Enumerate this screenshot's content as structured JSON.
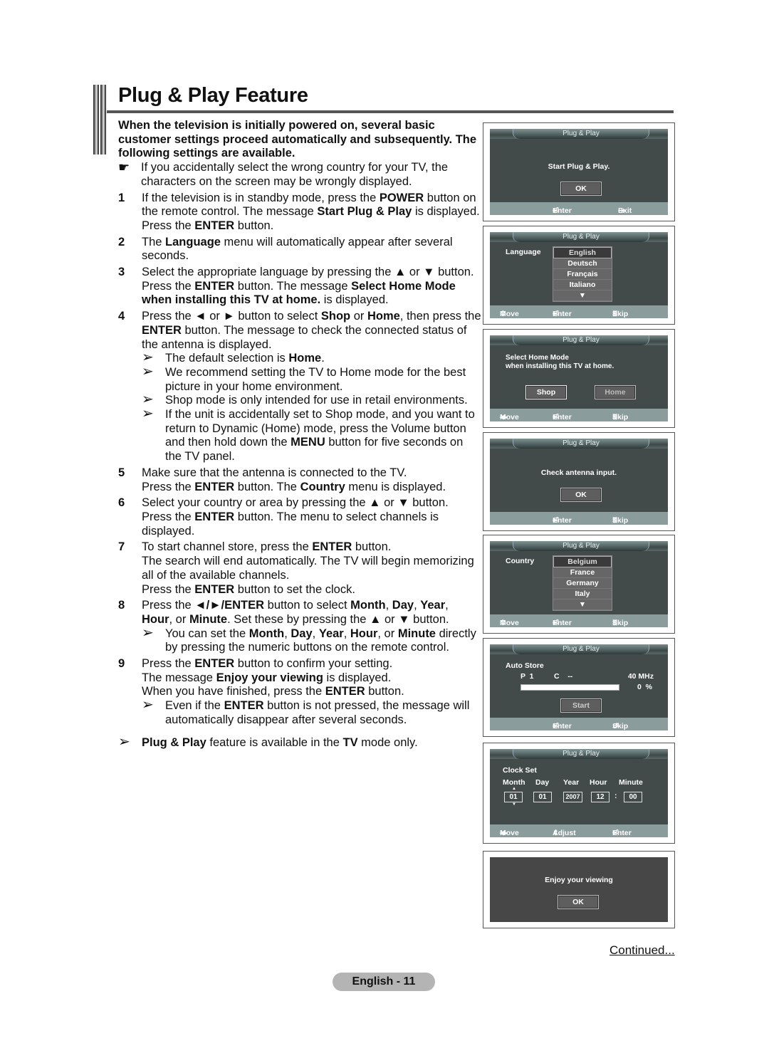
{
  "page": {
    "title": "Plug & Play Feature",
    "intro": "When the television is initially powered on, several basic customer settings proceed automatically and subsequently. The following settings are available.",
    "note": "If you accidentally select the wrong country for your TV, the characters on the screen may be wrongly displayed.",
    "continued": "Continued...",
    "page_label": "English - 11"
  },
  "steps": [
    {
      "num": "1",
      "html": "If the television is in standby mode, press the <b>POWER</b> button on the remote control. The message <b>Start Plug &amp; Play</b> is displayed. Press the <b>ENTER</b> button."
    },
    {
      "num": "2",
      "html": "The <b>Language</b> menu will automatically appear after several seconds."
    },
    {
      "num": "3",
      "html": "Select the appropriate language by pressing the ▲ or ▼ button. Press the <b>ENTER</b> button. The message <b>Select Home Mode when installing this TV at home.</b> is displayed."
    },
    {
      "num": "4",
      "html": "Press the ◄ or ► button to select <b>Shop</b> or <b>Home</b>, then press the <b>ENTER</b> button. The message to check the connected status of the antenna is displayed.",
      "subs": [
        "The default selection is <b>Home</b>.",
        "We recommend setting the TV to Home mode for the best picture in your home environment.",
        "Shop mode is only intended for use in retail environments.",
        "If the unit is accidentally set to Shop mode, and you want to return to Dynamic (Home) mode, press the Volume button and then hold down the <b>MENU</b> button for five seconds on the TV panel."
      ]
    },
    {
      "num": "5",
      "html": "Make sure that the antenna is connected to the TV.<br>Press the <b>ENTER</b> button. The <b>Country</b> menu is displayed."
    },
    {
      "num": "6",
      "html": "Select your country or area by pressing the ▲ or ▼ button. Press the <b>ENTER</b> button. The menu to select channels is displayed."
    },
    {
      "num": "7",
      "html": "To start channel store, press the <b>ENTER</b> button.<br>The search will end automatically. The TV will begin memorizing all of the available channels.<br>Press the <b>ENTER</b> button to set the clock."
    },
    {
      "num": "8",
      "html": "Press the <b>◄/►/ENTER</b> button to select <b>Month</b>, <b>Day</b>, <b>Year</b>, <b>Hour</b>, or <b>Minute</b>. Set these by pressing the ▲ or ▼ button.",
      "subs": [
        "You can set the <b>Month</b>, <b>Day</b>, <b>Year</b>, <b>Hour</b>, or <b>Minute</b> directly by pressing the numeric buttons on the remote control."
      ]
    },
    {
      "num": "9",
      "html": "Press the <b>ENTER</b> button to confirm your setting.<br>The message <b>Enjoy your viewing</b> is displayed.<br>When you have finished, press the <b>ENTER</b> button.",
      "subs": [
        "Even if the <b>ENTER</b> button is not pressed, the message will automatically disappear after several seconds."
      ]
    }
  ],
  "final_note": "<b>Plug &amp; Play</b> feature is available in the <b>TV</b> mode only.",
  "icons": {
    "hand": "☛",
    "arrow": "➢",
    "move_ud": "⇕",
    "move_lr": "◂▸",
    "enter": "⏎",
    "exit": "⇥",
    "skip": "Ⅲ",
    "return": "↺",
    "down": "▼",
    "up": "▲"
  },
  "screens": {
    "header": "Plug & Play",
    "s1": {
      "message": "Start Plug & Play.",
      "ok": "OK",
      "enter": "Enter",
      "exit": "Exit"
    },
    "s2": {
      "label": "Language",
      "options": [
        "English",
        "Deutsch",
        "Français",
        "Italiano"
      ],
      "selected": "English",
      "move": "Move",
      "enter": "Enter",
      "skip": "Skip"
    },
    "s3": {
      "line1": "Select Home Mode",
      "line2": "when installing this TV at home.",
      "shop": "Shop",
      "home": "Home",
      "move": "Move",
      "enter": "Enter",
      "skip": "Skip"
    },
    "s4": {
      "message": "Check antenna input.",
      "ok": "OK",
      "enter": "Enter",
      "skip": "Skip"
    },
    "s5": {
      "label": "Country",
      "options": [
        "Belgium",
        "France",
        "Germany",
        "Italy"
      ],
      "selected": "Belgium",
      "move": "Move",
      "enter": "Enter",
      "skip": "Skip"
    },
    "s6": {
      "label": "Auto Store",
      "p": "P  1",
      "c": "C    --",
      "freq": "40 MHz",
      "progress": "0  %",
      "progress_value": 0,
      "start": "Start",
      "enter": "Enter",
      "skip": "Skip"
    },
    "s7": {
      "label": "Clock Set",
      "fields": [
        "Month",
        "Day",
        "Year",
        "Hour",
        "Minute"
      ],
      "values": [
        "01",
        "01",
        "2007",
        "12",
        "00"
      ],
      "sep": ":",
      "move": "Move",
      "adjust": "Adjust",
      "enter": "Enter"
    },
    "s8": {
      "message": "Enjoy your viewing",
      "ok": "OK"
    }
  }
}
